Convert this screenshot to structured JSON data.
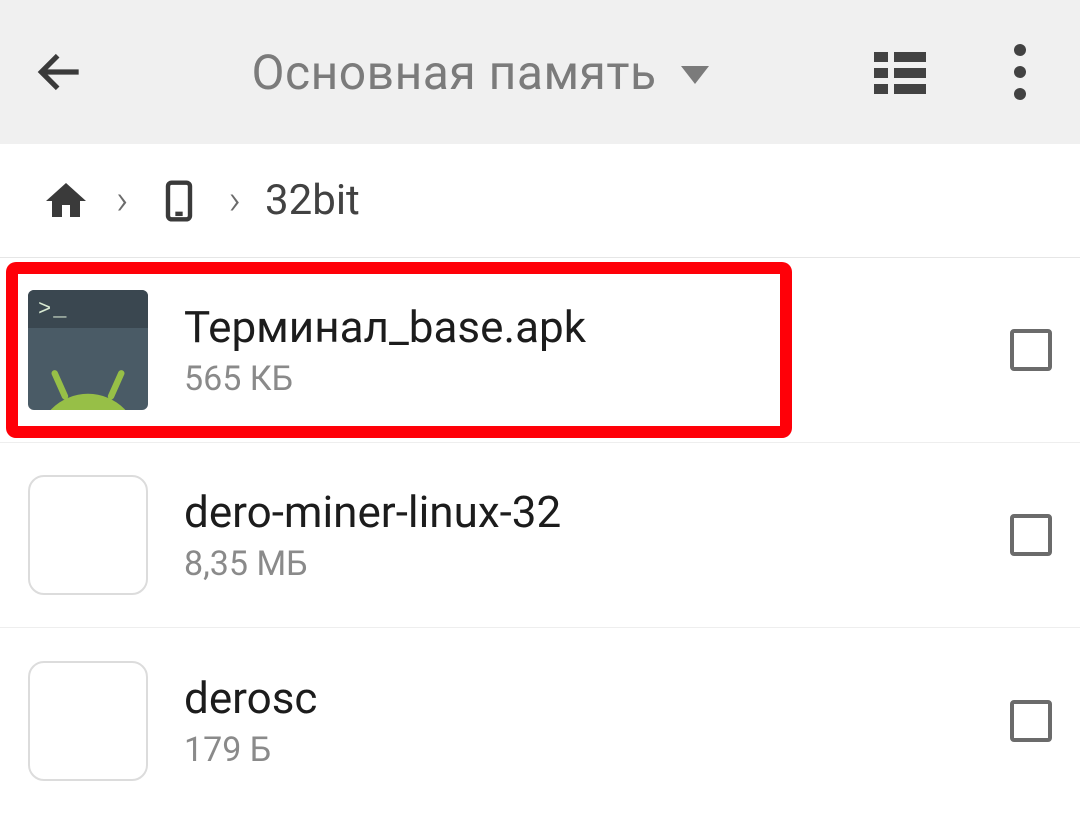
{
  "appbar": {
    "title": "Основная память"
  },
  "breadcrumb": {
    "current": "32bit"
  },
  "files": [
    {
      "name": "Терминал_base.apk",
      "size": "565 КБ",
      "kind": "apk",
      "highlighted": true
    },
    {
      "name": "dero-miner-linux-32",
      "size": "8,35 МБ",
      "kind": "blank",
      "highlighted": false
    },
    {
      "name": "derosc",
      "size": "179 Б",
      "kind": "blank",
      "highlighted": false
    }
  ],
  "icons": {
    "terminal_prompt": ">_"
  }
}
